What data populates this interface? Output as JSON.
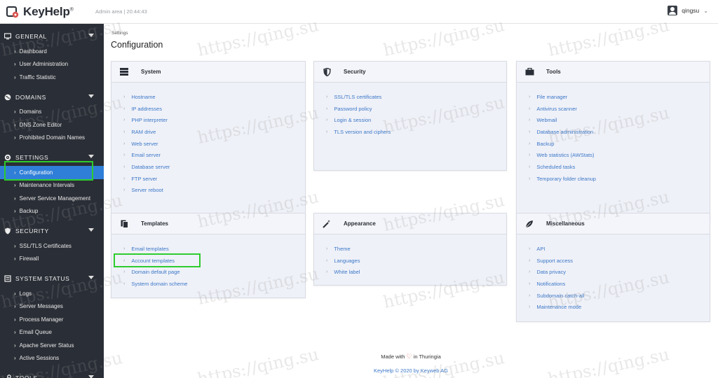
{
  "app": {
    "name": "KeyHelp",
    "trademark": "®",
    "admin_area": "Admin area | 20:44:43"
  },
  "user": {
    "name": "qingsu"
  },
  "sidebar": {
    "sections": [
      {
        "title": "GENERAL",
        "icon": "monitor-icon",
        "items": [
          "Dashboard",
          "User Administration",
          "Traffic Statistic"
        ]
      },
      {
        "title": "DOMAINS",
        "icon": "globe-icon",
        "items": [
          "Domains",
          "DNS Zone Editor",
          "Prohibited Domain Names"
        ]
      },
      {
        "title": "SETTINGS",
        "icon": "gear-icon",
        "items": [
          "Configuration",
          "Maintenance Intervals",
          "Server Service Management",
          "Backup"
        ]
      },
      {
        "title": "SECURITY",
        "icon": "shield-icon",
        "items": [
          "SSL/TLS Certificates",
          "Firewall"
        ]
      },
      {
        "title": "SYSTEM STATUS",
        "icon": "list-icon",
        "items": [
          "Logs",
          "Server Messages",
          "Process Manager",
          "Email Queue",
          "Apache Server Status",
          "Active Sessions"
        ]
      },
      {
        "title": "TOOLS",
        "icon": "wrench-icon",
        "items": []
      }
    ],
    "active_item": "Configuration"
  },
  "breadcrumb": "Settings",
  "page_title": "Configuration",
  "cards": [
    {
      "title": "System",
      "icon": "server-icon",
      "links": [
        "Hostname",
        "IP addresses",
        "PHP interpreter",
        "RAM drive",
        "Web server",
        "Email server",
        "Database server",
        "FTP server",
        "Server reboot"
      ]
    },
    {
      "title": "Security",
      "icon": "shield-icon",
      "links": [
        "SSL/TLS certificates",
        "Password policy",
        "Login & session",
        "TLS version and ciphers"
      ]
    },
    {
      "title": "Tools",
      "icon": "briefcase-icon",
      "links": [
        "File manager",
        "Antivirus scanner",
        "Webmail",
        "Database administration",
        "Backup",
        "Web statistics (AWStats)",
        "Scheduled tasks",
        "Temporary folder cleanup"
      ]
    },
    {
      "title": "Templates",
      "icon": "copy-icon",
      "links": [
        "Email templates",
        "Account templates",
        "Domain default page",
        "System domain scheme"
      ]
    },
    {
      "title": "Appearance",
      "icon": "magic-wand-icon",
      "links": [
        "Theme",
        "Languages",
        "White label"
      ]
    },
    {
      "title": "Miscellaneous",
      "icon": "leaf-icon",
      "links": [
        "API",
        "Support access",
        "Data privacy",
        "Notifications",
        "Subdomain catch-all",
        "Maintenance mode"
      ]
    }
  ],
  "footer": {
    "made_with_prefix": "Made with",
    "made_with_suffix": "in Thuringia",
    "copyright": "KeyHelp © 2020 by Keyweb AG"
  },
  "watermark": "https://qing.su",
  "colors": {
    "sidebar_bg": "#2a2e36",
    "active": "#2f7fd8",
    "link": "#3c78c8",
    "highlight": "#2ecc2e",
    "card_bg": "#eff1f8"
  }
}
